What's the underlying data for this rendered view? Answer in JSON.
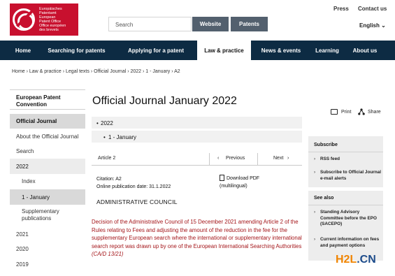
{
  "header": {
    "logo": {
      "line1": "Europäisches",
      "line2": "Patentamt",
      "line3": "European",
      "line4": "Patent Office",
      "line5": "Office européen",
      "line6": "des brevets"
    },
    "search_placeholder": "Search",
    "search_tabs": [
      "Website",
      "Patents"
    ],
    "links": {
      "press": "Press",
      "contact": "Contact us"
    },
    "language": "English"
  },
  "nav": {
    "items": [
      "Home",
      "Searching for patents",
      "Applying for a patent",
      "Law & practice",
      "News & events",
      "Learning",
      "About us"
    ]
  },
  "breadcrumb": "Home › Law & practice › Legal texts › Official Journal › 2022 › 1 - January › A2",
  "sidebar": {
    "items": [
      "European Patent Convention",
      "Official Journal",
      "About the Official Journal",
      "Search",
      "2022",
      "Index",
      "1 - January",
      "Supplementary publications",
      "2021",
      "2020",
      "2019"
    ]
  },
  "main": {
    "title": "Official Journal January 2022",
    "print": "Print",
    "share": "Share",
    "tree": {
      "year": "2022",
      "month": "1 - January"
    },
    "article": {
      "label": "Article 2",
      "previous": "Previous",
      "next": "Next"
    },
    "citation": "Citation: A2",
    "online_date": "Online publication date: 31.1.2022",
    "pdf_label": "Download PDF",
    "pdf_sub": "(multilingual)",
    "council": "ADMINISTRATIVE COUNCIL",
    "decision_text": "Decision of the Administrative Council of 15 December 2021 amending Article 2 of the Rules relating to Fees and adjusting the amount of the reduction in the fee for the supplementary European search where the international or supplementary international search report was drawn up by one of the European International Searching Authorities",
    "decision_ref": "(CA/D 13/21)"
  },
  "aside": {
    "subscribe_title": "Subscribe",
    "subscribe_links": [
      "RSS feed",
      "Subscribe to Official Journal e-mail alerts"
    ],
    "see_also_title": "See also",
    "see_also_links": [
      "Standing Advisory Committee before the EPO (SACEPO)",
      "Current information on fees and payment options"
    ]
  },
  "watermark": {
    "part1": "H2L",
    "part2": ".CN"
  },
  "colors": {
    "brand_red": "#c8102e",
    "nav_bg": "#0d2b43",
    "decision_red": "#a4161a"
  }
}
